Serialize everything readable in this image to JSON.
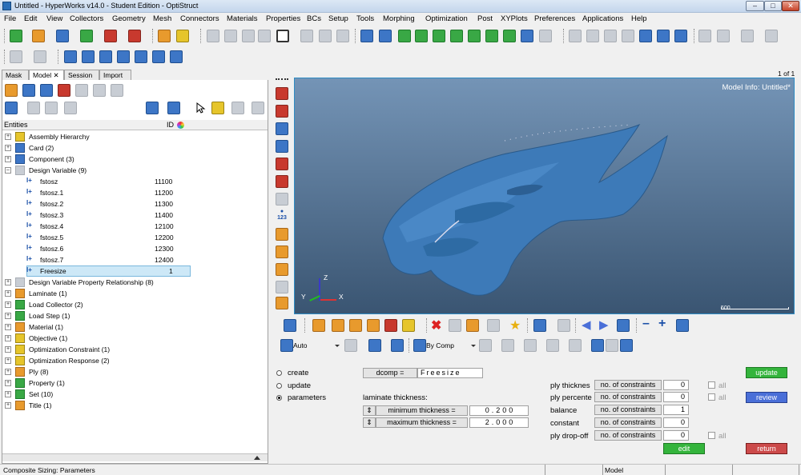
{
  "window": {
    "title": "Untitled - HyperWorks v14.0 - Student Edition - OptiStruct"
  },
  "menu": [
    "File",
    "Edit",
    "View",
    "Collectors",
    "Geometry",
    "Mesh",
    "Connectors",
    "Materials",
    "Properties",
    "BCs",
    "Setup",
    "Tools",
    "Morphing",
    "Optimization",
    "Post",
    "XYPlots",
    "Preferences",
    "Applications",
    "Help"
  ],
  "tabs": [
    "Mask",
    "Model",
    "Session",
    "Import"
  ],
  "entities": {
    "header": "Entities",
    "id_header": "ID"
  },
  "tree": [
    {
      "label": "Assembly Hierarchy",
      "id": "",
      "level": 0,
      "expanded": false
    },
    {
      "label": "Card (2)",
      "id": "",
      "level": 0,
      "expanded": false
    },
    {
      "label": "Component (3)",
      "id": "",
      "level": 0,
      "expanded": false
    },
    {
      "label": "Design Variable (9)",
      "id": "",
      "level": 0,
      "expanded": true
    },
    {
      "label": "fstosz",
      "id": "11100",
      "level": 1
    },
    {
      "label": "fstosz.1",
      "id": "11200",
      "level": 1
    },
    {
      "label": "fstosz.2",
      "id": "11300",
      "level": 1
    },
    {
      "label": "fstosz.3",
      "id": "11400",
      "level": 1
    },
    {
      "label": "fstosz.4",
      "id": "12100",
      "level": 1
    },
    {
      "label": "fstosz.5",
      "id": "12200",
      "level": 1
    },
    {
      "label": "fstosz.6",
      "id": "12300",
      "level": 1
    },
    {
      "label": "fstosz.7",
      "id": "12400",
      "level": 1
    },
    {
      "label": "Freesize",
      "id": "1",
      "level": 1,
      "selected": true
    },
    {
      "label": "Design Variable Property Relationship (8)",
      "id": "",
      "level": 0
    },
    {
      "label": "Laminate (1)",
      "id": "",
      "level": 0
    },
    {
      "label": "Load Collector (2)",
      "id": "",
      "level": 0
    },
    {
      "label": "Load Step (1)",
      "id": "",
      "level": 0
    },
    {
      "label": "Material (1)",
      "id": "",
      "level": 0
    },
    {
      "label": "Objective (1)",
      "id": "",
      "level": 0
    },
    {
      "label": "Optimization Constraint (1)",
      "id": "",
      "level": 0
    },
    {
      "label": "Optimization Response (2)",
      "id": "",
      "level": 0
    },
    {
      "label": "Ply (8)",
      "id": "",
      "level": 0
    },
    {
      "label": "Property (1)",
      "id": "",
      "level": 0
    },
    {
      "label": "Set (10)",
      "id": "",
      "level": 0
    },
    {
      "label": "Title (1)",
      "id": "",
      "level": 0
    }
  ],
  "graphics": {
    "page": "1 of 1",
    "model_info": "Model Info: Untitled*",
    "scale": "500",
    "axis": {
      "x": "X",
      "y": "Y",
      "z": "Z"
    }
  },
  "visual_toolbar": {
    "auto": "Auto",
    "by_comp": "By Comp"
  },
  "form": {
    "radios": [
      {
        "label": "create",
        "checked": false
      },
      {
        "label": "update",
        "checked": false
      },
      {
        "label": "parameters",
        "checked": true
      }
    ],
    "dcomp_btn": "dcomp =",
    "dcomp_value": "Freesize",
    "laminate_label": "laminate thickness:",
    "min_label": "minimum thickness =",
    "min_value": "0.200",
    "max_label": "maximum thickness =",
    "max_value": "2.000",
    "rows": [
      {
        "label": "ply thicknes",
        "btn": "no. of constraints",
        "value": "0",
        "all": "all"
      },
      {
        "label": "ply percente",
        "btn": "no. of constraints",
        "value": "0",
        "all": "all"
      },
      {
        "label": "balance",
        "btn": "no. of constraints",
        "value": "1",
        "all": ""
      },
      {
        "label": "constant",
        "btn": "no. of constraints",
        "value": "0",
        "all": ""
      },
      {
        "label": "ply drop-off",
        "btn": "no. of constraints",
        "value": "0",
        "all": "all"
      }
    ],
    "update_btn": "update",
    "review_btn": "review",
    "edit_btn": "edit",
    "return_btn": "return"
  },
  "status": {
    "left": "Composite Sizing: Parameters",
    "model": "Model"
  }
}
